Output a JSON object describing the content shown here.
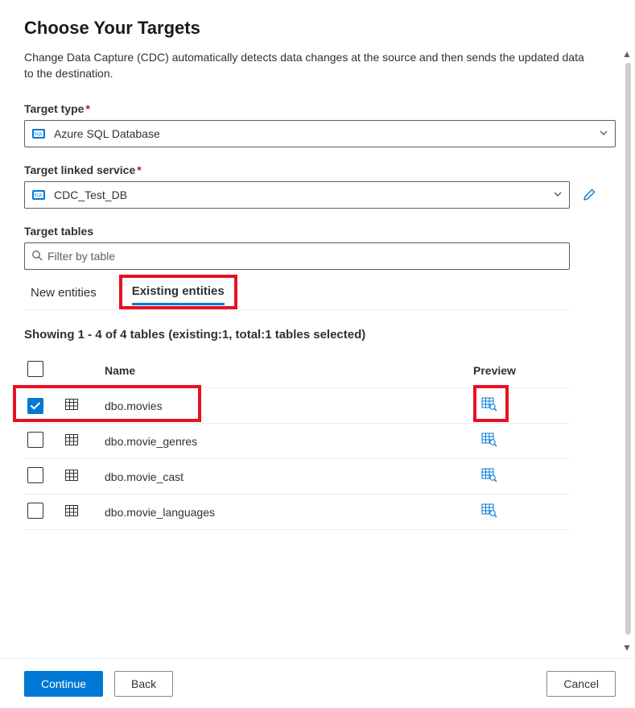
{
  "header": {
    "title": "Choose Your Targets",
    "description": "Change Data Capture (CDC) automatically detects data changes at the source and then sends the updated data to the destination."
  },
  "fields": {
    "target_type": {
      "label": "Target type",
      "value": "Azure SQL Database"
    },
    "target_linked_service": {
      "label": "Target linked service",
      "value": "CDC_Test_DB"
    },
    "target_tables": {
      "label": "Target tables",
      "filter_placeholder": "Filter by table"
    }
  },
  "tabs": {
    "new": "New entities",
    "existing": "Existing entities",
    "active": "existing"
  },
  "results": {
    "showing_text": "Showing 1 - 4 of 4 tables (existing:1, total:1 tables selected)",
    "columns": {
      "name": "Name",
      "preview": "Preview"
    },
    "rows": [
      {
        "name": "dbo.movies",
        "checked": true
      },
      {
        "name": "dbo.movie_genres",
        "checked": false
      },
      {
        "name": "dbo.movie_cast",
        "checked": false
      },
      {
        "name": "dbo.movie_languages",
        "checked": false
      }
    ]
  },
  "footer": {
    "continue": "Continue",
    "back": "Back",
    "cancel": "Cancel"
  }
}
